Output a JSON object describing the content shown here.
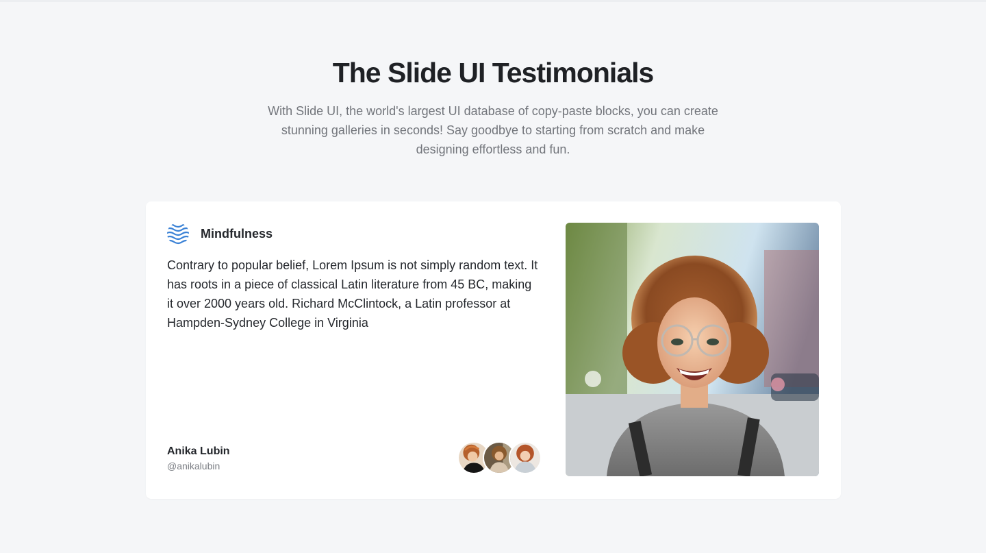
{
  "hero": {
    "title": "The Slide UI Testimonials",
    "subtitle": "With Slide UI, the world's largest UI database of copy-paste blocks, you can create stunning galleries in seconds! Say goodbye to starting from scratch and make designing effortless and fun."
  },
  "testimonial": {
    "brand": {
      "name": "Mindfulness",
      "icon": "waves-icon",
      "color": "#3b82d6"
    },
    "quote": "Contrary to popular belief, Lorem Ipsum is not simply random text. It has roots in a piece of classical Latin literature from 45 BC, making it over 2000 years old. Richard McClintock, a Latin professor at Hampden-Sydney College in Virginia",
    "author": {
      "name": "Anika Lubin",
      "handle": "@anikalubin"
    },
    "avatars": [
      "avatar-woman-1",
      "avatar-woman-2",
      "avatar-woman-3"
    ],
    "photo": "portrait-smiling-woman-glasses"
  },
  "colors": {
    "background": "#f5f6f8",
    "card": "#ffffff",
    "heading": "#1f2125",
    "muted": "#72757b",
    "accent": "#3b82d6"
  }
}
